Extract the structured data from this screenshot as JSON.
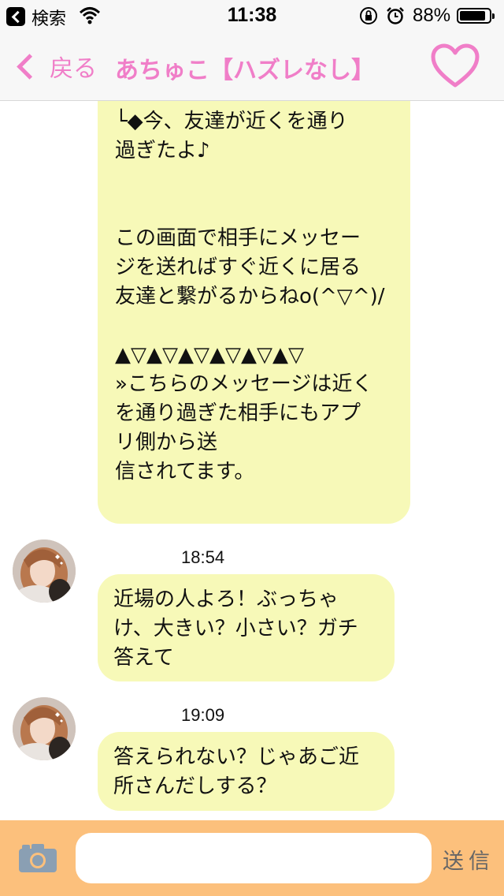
{
  "status_bar": {
    "back_app": "検索",
    "time": "11:38",
    "battery_percent": "88%",
    "battery_level": 0.88
  },
  "nav": {
    "back_label": "戻る",
    "title": "あちゅこ【ハズレなし】",
    "accent_color": "#f07ec8"
  },
  "messages": {
    "system": {
      "lines": [
        "└◆今、友達が近くを通り",
        "過ぎたよ♪",
        "",
        "",
        "この画面で相手にメッセー",
        "ジを送ればすぐ近くに居る",
        "友達と繋がるからねo(^▽^)/",
        "",
        "▲▽▲▽▲▽▲▽▲▽▲▽",
        "»こちらのメッセージは近く",
        "を通り過ぎた相手にもアプ",
        "リ側から送",
        "信されてます。"
      ]
    },
    "msg1": {
      "time": "18:54",
      "lines": [
        "近場の人よろ！ぶっちゃ",
        "け、大きい？小さい？ガチ",
        "答えて"
      ]
    },
    "msg2": {
      "time": "19:09",
      "lines": [
        "答えられない？じゃあご近",
        "所さんだしする？"
      ]
    },
    "bubble_color": "#f7f9b8"
  },
  "input_bar": {
    "placeholder": "",
    "send_label": "送信",
    "bar_color": "#fcc07c"
  }
}
